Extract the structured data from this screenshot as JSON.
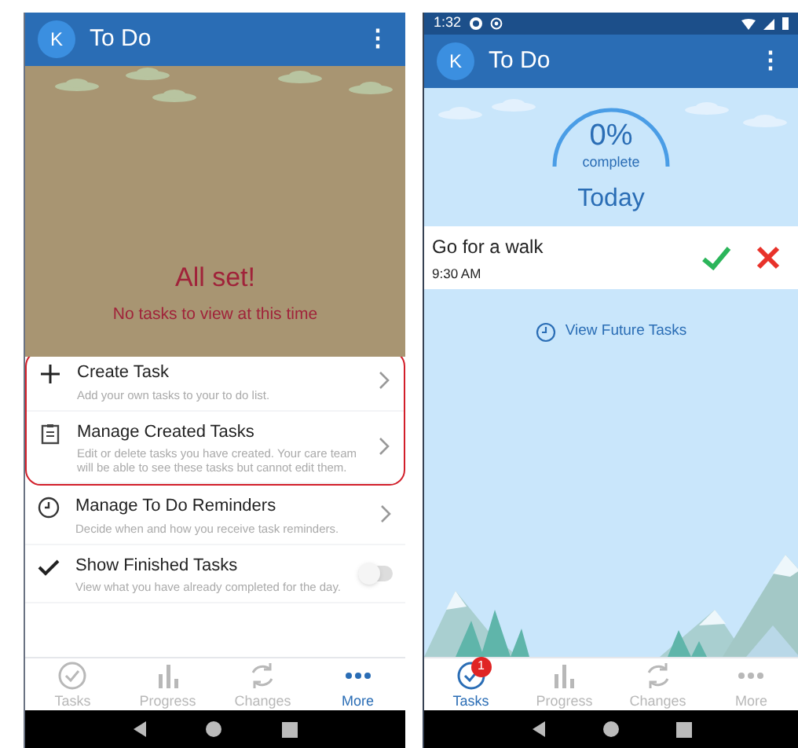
{
  "left_screen": {
    "app_bar": {
      "avatar": "K",
      "title": "To Do",
      "menu": "⋮"
    },
    "empty_state": {
      "title": "All set!",
      "message": "No tasks to view at this time"
    },
    "menu_items": [
      {
        "kind": "link",
        "title": "Create Task",
        "description": "Add your own tasks to your to do list.",
        "highlighted": true
      },
      {
        "kind": "link",
        "title": "Manage Created Tasks",
        "description": "Edit or delete tasks you have created. Your care team will be able to see these tasks but cannot edit them.",
        "highlighted": true
      },
      {
        "kind": "link",
        "title": "Manage To Do Reminders",
        "description": "Decide when and how you receive task reminders.",
        "highlighted": false
      },
      {
        "kind": "toggle",
        "title": "Show Finished Tasks",
        "description": "View what you have already completed for the day.",
        "highlighted": false,
        "on": false
      }
    ],
    "bottom_nav": [
      {
        "label": "Tasks",
        "selected": false
      },
      {
        "label": "Progress",
        "selected": false
      },
      {
        "label": "Changes",
        "selected": false
      },
      {
        "label": "More",
        "selected": true
      }
    ]
  },
  "right_screen": {
    "status_bar": {
      "time": "1:32"
    },
    "app_bar": {
      "avatar": "K",
      "title": "To Do",
      "menu": "⋮"
    },
    "progress": {
      "percent": "0%",
      "caption": "complete"
    },
    "section_title": "Today",
    "tasks": [
      {
        "title": "Go for a walk",
        "time": "9:30 AM"
      }
    ],
    "future_link": "View Future Tasks",
    "bottom_nav": [
      {
        "label": "Tasks",
        "selected": true,
        "badge": "1"
      },
      {
        "label": "Progress",
        "selected": false
      },
      {
        "label": "Changes",
        "selected": false
      },
      {
        "label": "More",
        "selected": false
      }
    ]
  }
}
